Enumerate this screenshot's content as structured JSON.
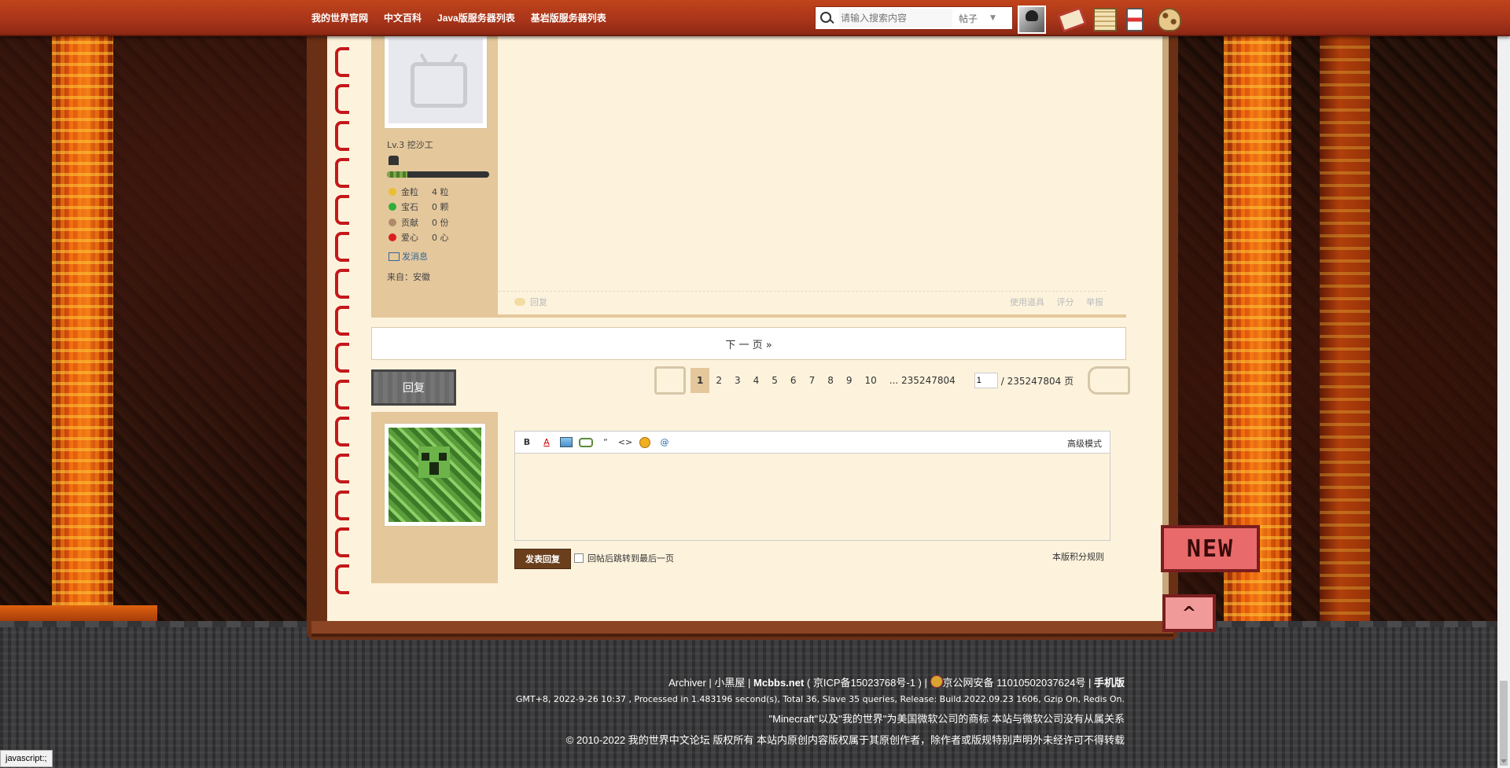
{
  "nav": {
    "links": [
      "我的世界官网",
      "中文百科",
      "Java版服务器列表",
      "基岩版服务器列表"
    ],
    "search_placeholder": "请输入搜索内容",
    "search_type": "帖子"
  },
  "post": {
    "rank": "Lv.3 挖沙工",
    "exp_progress": 0.2,
    "stats": [
      {
        "label": "金粒",
        "value": "4 粒",
        "color": "#e8c030"
      },
      {
        "label": "宝石",
        "value": "0 颗",
        "color": "#2fae3c"
      },
      {
        "label": "贡献",
        "value": "0 份",
        "color": "#b08a6a"
      },
      {
        "label": "爱心",
        "value": "0 心",
        "color": "#d82020"
      }
    ],
    "send_message": "发消息",
    "from": "来自：安徽",
    "reply_action": "回复",
    "use_tools": "使用道具",
    "rate": "评分",
    "report": "举报"
  },
  "pagination": {
    "next_page": "下 一 页  »",
    "reply_button": "回复",
    "pages": [
      "1",
      "2",
      "3",
      "4",
      "5",
      "6",
      "7",
      "8",
      "9",
      "10"
    ],
    "current": "1",
    "last": "... 235247804",
    "input_value": "1",
    "total": "/ 235247804 页"
  },
  "quick_reply": {
    "toolbar_icons": [
      "B",
      "A",
      "image-icon",
      "link-icon",
      "“",
      "<>",
      "smile-icon",
      "@"
    ],
    "advanced": "高级模式",
    "submit": "发表回复",
    "jump_last": "回帖后跳转到最后一页",
    "rules": "本版积分规则"
  },
  "badges": {
    "new": "NEW",
    "top": "^"
  },
  "footer": {
    "links": [
      "Archiver",
      "小黑屋",
      "Mcbbs.net"
    ],
    "icp": "( 京ICP备15023768号-1 )",
    "police": "京公网安备 11010502037624号",
    "mobile": "手机版",
    "stats": "GMT+8, 2022-9-26 10:37 , Processed in 1.483196 second(s), Total 36, Slave 35 queries, Release: Build.2022.09.23 1606, Gzip On, Redis On.",
    "trademark": "\"Minecraft\"以及\"我的世界\"为美国微软公司的商标 本站与微软公司没有从属关系",
    "copyright": "© 2010-2022 我的世界中文论坛 版权所有 本站内原创内容版权属于其原创作者，除作者或版规特别声明外未经许可不得转载"
  },
  "status_bar": "javascript:;"
}
